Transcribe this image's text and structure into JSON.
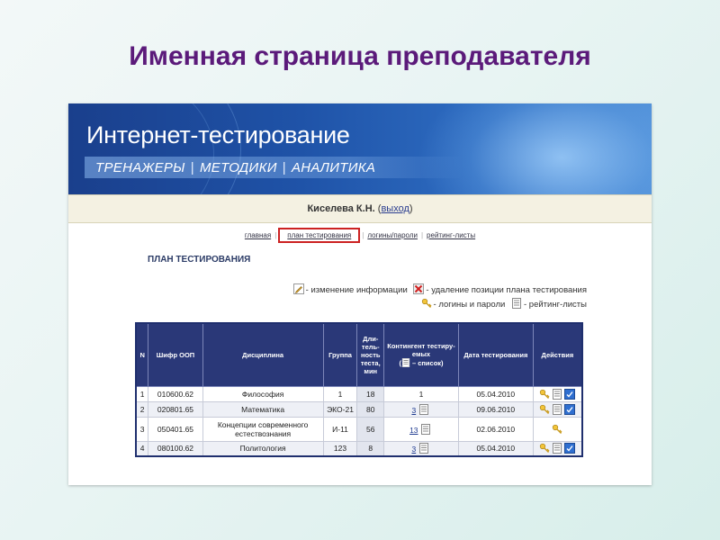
{
  "slide": {
    "title": "Именная страница преподавателя"
  },
  "site": {
    "title": "Интернет-тестирование",
    "nav": [
      "ТРЕНАЖЕРЫ",
      "МЕТОДИКИ",
      "АНАЛИТИКА"
    ]
  },
  "user": {
    "name": "Киселева К.Н.",
    "logout_label": "выход"
  },
  "tabs": {
    "items": [
      "главная",
      "план тестирования",
      "логины/пароли",
      "рейтинг-листы"
    ],
    "active": "план тестирования"
  },
  "plan": {
    "title": "ПЛАН ТЕСТИРОВАНИЯ",
    "legend": {
      "edit": "- изменение информации",
      "delete": "- удаление позиции плана тестирования",
      "logins": "- логины и пароли",
      "rating": "- рейтинг-листы"
    },
    "columns": {
      "num": "N",
      "code": "Шифр ООП",
      "discipline": "Дисциплина",
      "group": "Группа",
      "duration": "Дли-тель-ность теста, мин",
      "contingent": "Контингент тестиру-емых",
      "contingent_list": "– список)",
      "date": "Дата тестирования",
      "actions": "Действия"
    },
    "rows": [
      {
        "num": "1",
        "code": "010600.62",
        "discipline": "Философия",
        "group": "1",
        "duration": "18",
        "contingent": "1",
        "date": "05.04.2010"
      },
      {
        "num": "2",
        "code": "020801.65",
        "discipline": "Математика",
        "group": "ЭКО-21",
        "duration": "80",
        "contingent": "3",
        "date": "09.06.2010"
      },
      {
        "num": "3",
        "code": "050401.65",
        "discipline": "Концепции современного естествознания",
        "group": "И-11",
        "duration": "56",
        "contingent": "13",
        "date": "02.06.2010"
      },
      {
        "num": "4",
        "code": "080100.62",
        "discipline": "Политология",
        "group": "123",
        "duration": "8",
        "contingent": "3",
        "date": "05.04.2010"
      }
    ]
  },
  "colors": {
    "slide_title": "#5b1a7a",
    "banner": "#1f53a8",
    "table_header": "#2a3878",
    "highlight": "#cc2222"
  },
  "icons": [
    "pencil-icon",
    "delete-icon",
    "key-icon",
    "list-icon",
    "rating-icon"
  ]
}
